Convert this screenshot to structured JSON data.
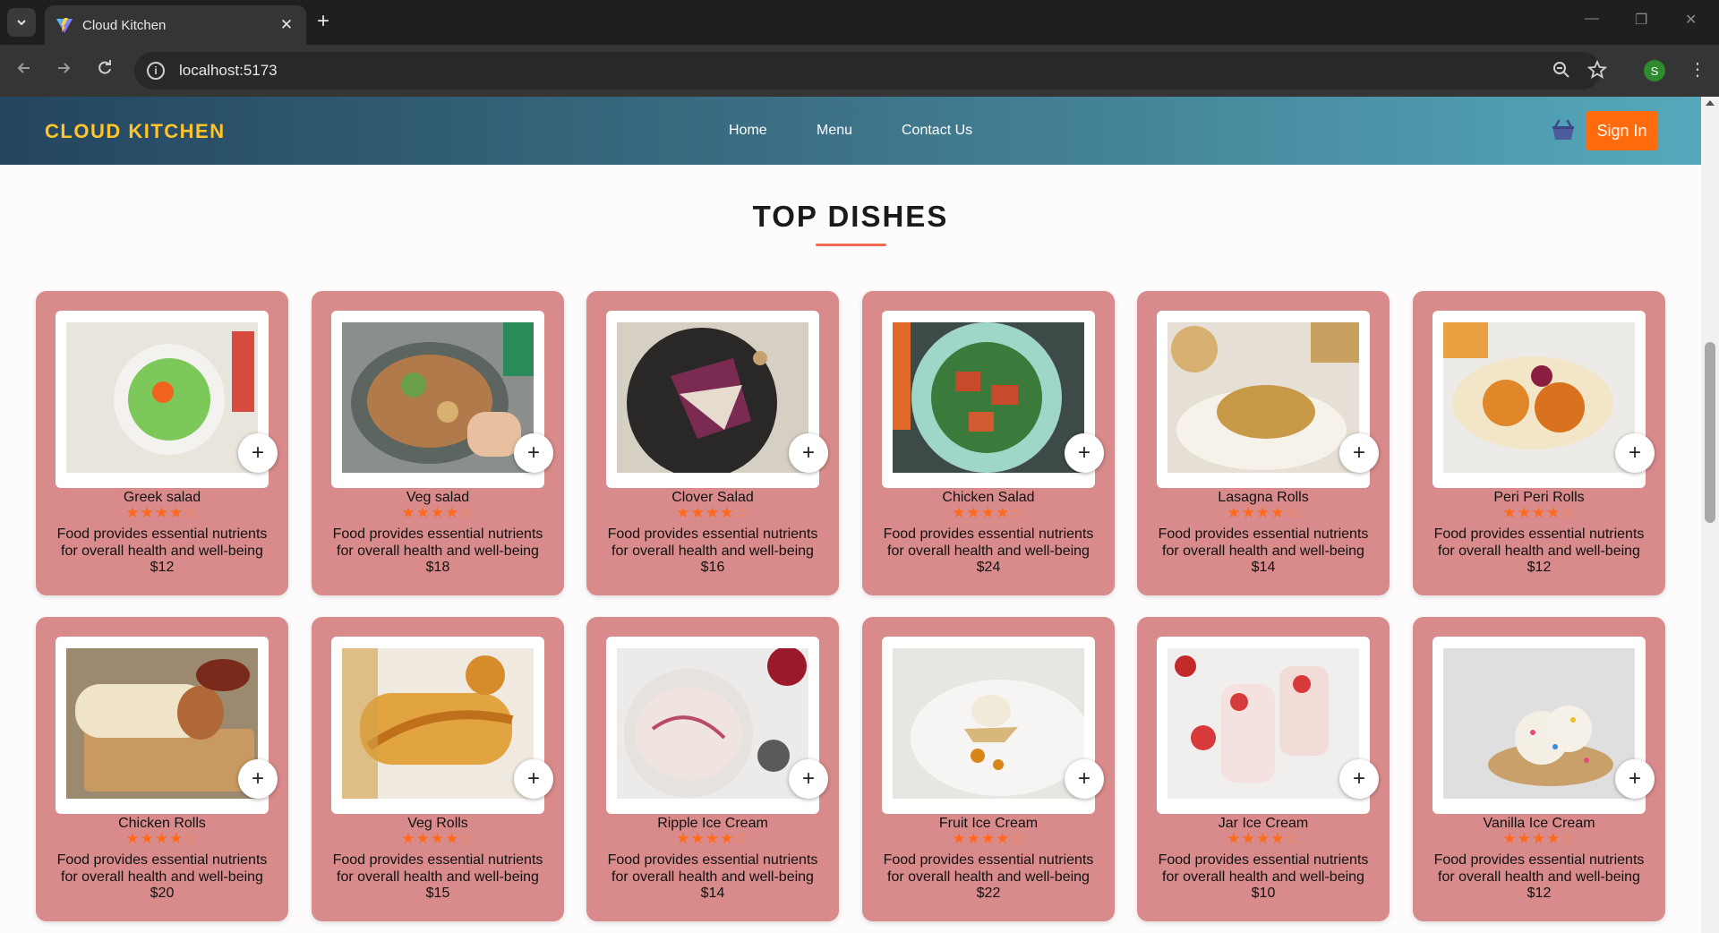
{
  "browser": {
    "tab_title": "Cloud Kitchen",
    "tab_close": "✕",
    "new_tab": "+",
    "url": "localhost:5173",
    "profile_initial": "S",
    "window_controls": {
      "minimize": "—",
      "restore": "❐",
      "close": "✕"
    }
  },
  "header": {
    "brand": "CLOUD KITCHEN",
    "nav": [
      "Home",
      "Menu",
      "Contact Us"
    ],
    "sign_in": "Sign In",
    "colors": {
      "brand": "#ffc52b",
      "button": "#ff6a0d"
    }
  },
  "section": {
    "title": "TOP DISHES"
  },
  "rating_display": {
    "filled": 4,
    "max": 5
  },
  "dishes": [
    {
      "name": "Greek salad",
      "desc_line1": "Food provides essential nutrients",
      "desc_line2": "for overall health and well-being",
      "price": "$12",
      "image": "bowl of green peas salad with orange center"
    },
    {
      "name": "Veg salad",
      "desc_line1": "Food provides essential nutrients",
      "desc_line2": "for overall health and well-being",
      "price": "$18",
      "image": "salad bowl with hand holding fork"
    },
    {
      "name": "Clover Salad",
      "desc_line1": "Food provides essential nutrients",
      "desc_line2": "for overall health and well-being",
      "price": "$16",
      "image": "endive salad on dark plate"
    },
    {
      "name": "Chicken Salad",
      "desc_line1": "Food provides essential nutrients",
      "desc_line2": "for overall health and well-being",
      "price": "$24",
      "image": "grilled chicken salad on mint plate"
    },
    {
      "name": "Lasagna Rolls",
      "desc_line1": "Food provides essential nutrients",
      "desc_line2": "for overall health and well-being",
      "price": "$14",
      "image": "lasagna rolls on white plates"
    },
    {
      "name": "Peri Peri Rolls",
      "desc_line1": "Food provides essential nutrients",
      "desc_line2": "for overall health and well-being",
      "price": "$12",
      "image": "wraps with spicy filling"
    },
    {
      "name": "Chicken Rolls",
      "desc_line1": "Food provides essential nutrients",
      "desc_line2": "for overall health and well-being",
      "price": "$20",
      "image": "chicken burrito on wooden board"
    },
    {
      "name": "Veg Rolls",
      "desc_line1": "Food provides essential nutrients",
      "desc_line2": "for overall health and well-being",
      "price": "$15",
      "image": "baked rolls with sesame"
    },
    {
      "name": "Ripple Ice Cream",
      "desc_line1": "Food provides essential nutrients",
      "desc_line2": "for overall health and well-being",
      "price": "$14",
      "image": "berry ripple ice cream bowl"
    },
    {
      "name": "Fruit Ice Cream",
      "desc_line1": "Food provides essential nutrients",
      "desc_line2": "for overall health and well-being",
      "price": "$22",
      "image": "plated dessert with ice cream"
    },
    {
      "name": "Jar Ice Cream",
      "desc_line1": "Food provides essential nutrients",
      "desc_line2": "for overall health and well-being",
      "price": "$10",
      "image": "jars of strawberry dessert"
    },
    {
      "name": "Vanilla Ice Cream",
      "desc_line1": "Food provides essential nutrients",
      "desc_line2": "for overall health and well-being",
      "price": "$12",
      "image": "vanilla ice cream with sprinkles"
    }
  ]
}
